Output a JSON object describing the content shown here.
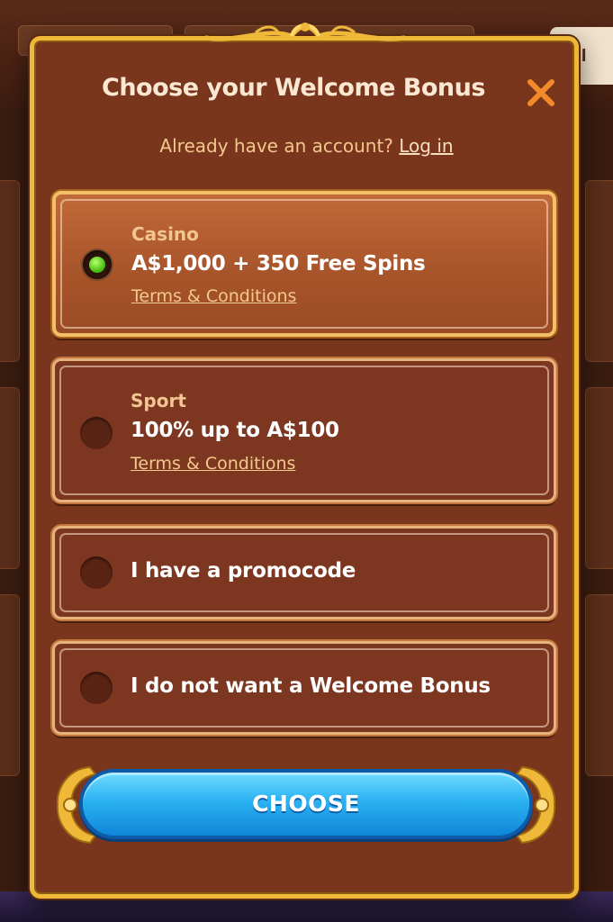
{
  "background": {
    "right_tab_text": "OPI"
  },
  "modal": {
    "title": "Choose your Welcome Bonus",
    "close_icon": "close-x-icon",
    "login_prompt": "Already have an account?",
    "login_link": "Log in"
  },
  "options": [
    {
      "category": "Casino",
      "main": "A$1,000 + 350 Free Spins",
      "terms": "Terms & Conditions",
      "selected": true
    },
    {
      "category": "Sport",
      "main": "100% up to A$100",
      "terms": "Terms & Conditions",
      "selected": false
    },
    {
      "main": "I have a promocode",
      "selected": false
    },
    {
      "main": "I do not want a Welcome Bonus",
      "selected": false
    }
  ],
  "choose_button": "CHOOSE",
  "colors": {
    "modal_bg": "#7a351d",
    "gold_frame": "#f0b838",
    "button_blue": "#2bb2f2",
    "radio_selected": "#4ec21a",
    "close_orange": "#f38a2a"
  }
}
